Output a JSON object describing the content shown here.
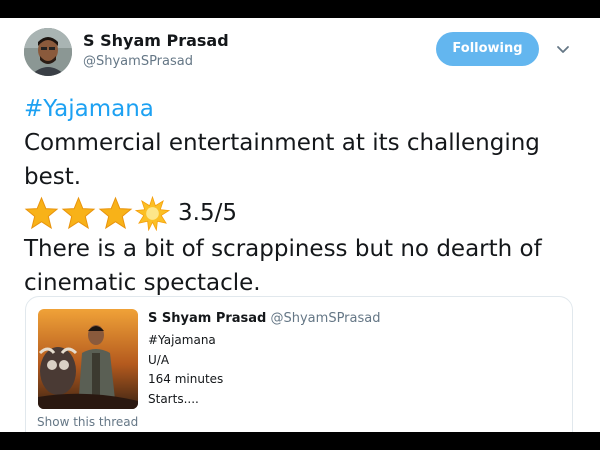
{
  "user": {
    "display_name": "S Shyam Prasad",
    "handle": "@ShyamSPrasad",
    "follow_label": "Following"
  },
  "tweet": {
    "hashtag": "#Yajamana",
    "line1": "Commercial entertainment at its challenging best.",
    "rating_text": "3.5/5",
    "stars": {
      "full": 3,
      "half": 1
    },
    "line2": "There is a bit of scrappiness but no dearth of cinematic spectacle."
  },
  "quoted": {
    "display_name": "S Shyam Prasad",
    "handle": "@ShyamSPrasad",
    "lines": [
      "#Yajamana",
      "U/A",
      "164 minutes",
      "Starts...."
    ],
    "show_thread": "Show this thread"
  },
  "colors": {
    "accent": "#1da1f2",
    "follow_button": "#63b6ef",
    "star": "#f8b218"
  },
  "icons": {
    "menu": "chevron-down-icon",
    "star": "star-icon",
    "half_star": "half-star-icon"
  }
}
